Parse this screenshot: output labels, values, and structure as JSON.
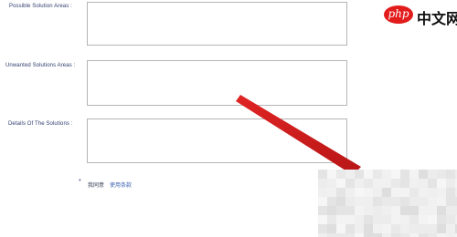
{
  "form": {
    "fields": [
      {
        "label": "Possible Solution Areas :",
        "value": ""
      },
      {
        "label": "Unwanted Solutions Areas :",
        "value": ""
      },
      {
        "label": "Details Of The Solutions :",
        "value": ""
      }
    ],
    "agreement": {
      "asterisk": "*",
      "text": "我同意",
      "link": "使用条款"
    }
  },
  "watermark": {
    "badge": "php",
    "text": "中文网"
  },
  "colors": {
    "label": "#2f3d6e",
    "link": "#3a5fb0",
    "field_border": "#b5b5b5",
    "arrow": "#d81c1c",
    "watermark_red": "#e21b1b"
  },
  "decorations": {
    "arrow_color_name": "red-arrow",
    "mosaic_name": "pixelated-region"
  }
}
